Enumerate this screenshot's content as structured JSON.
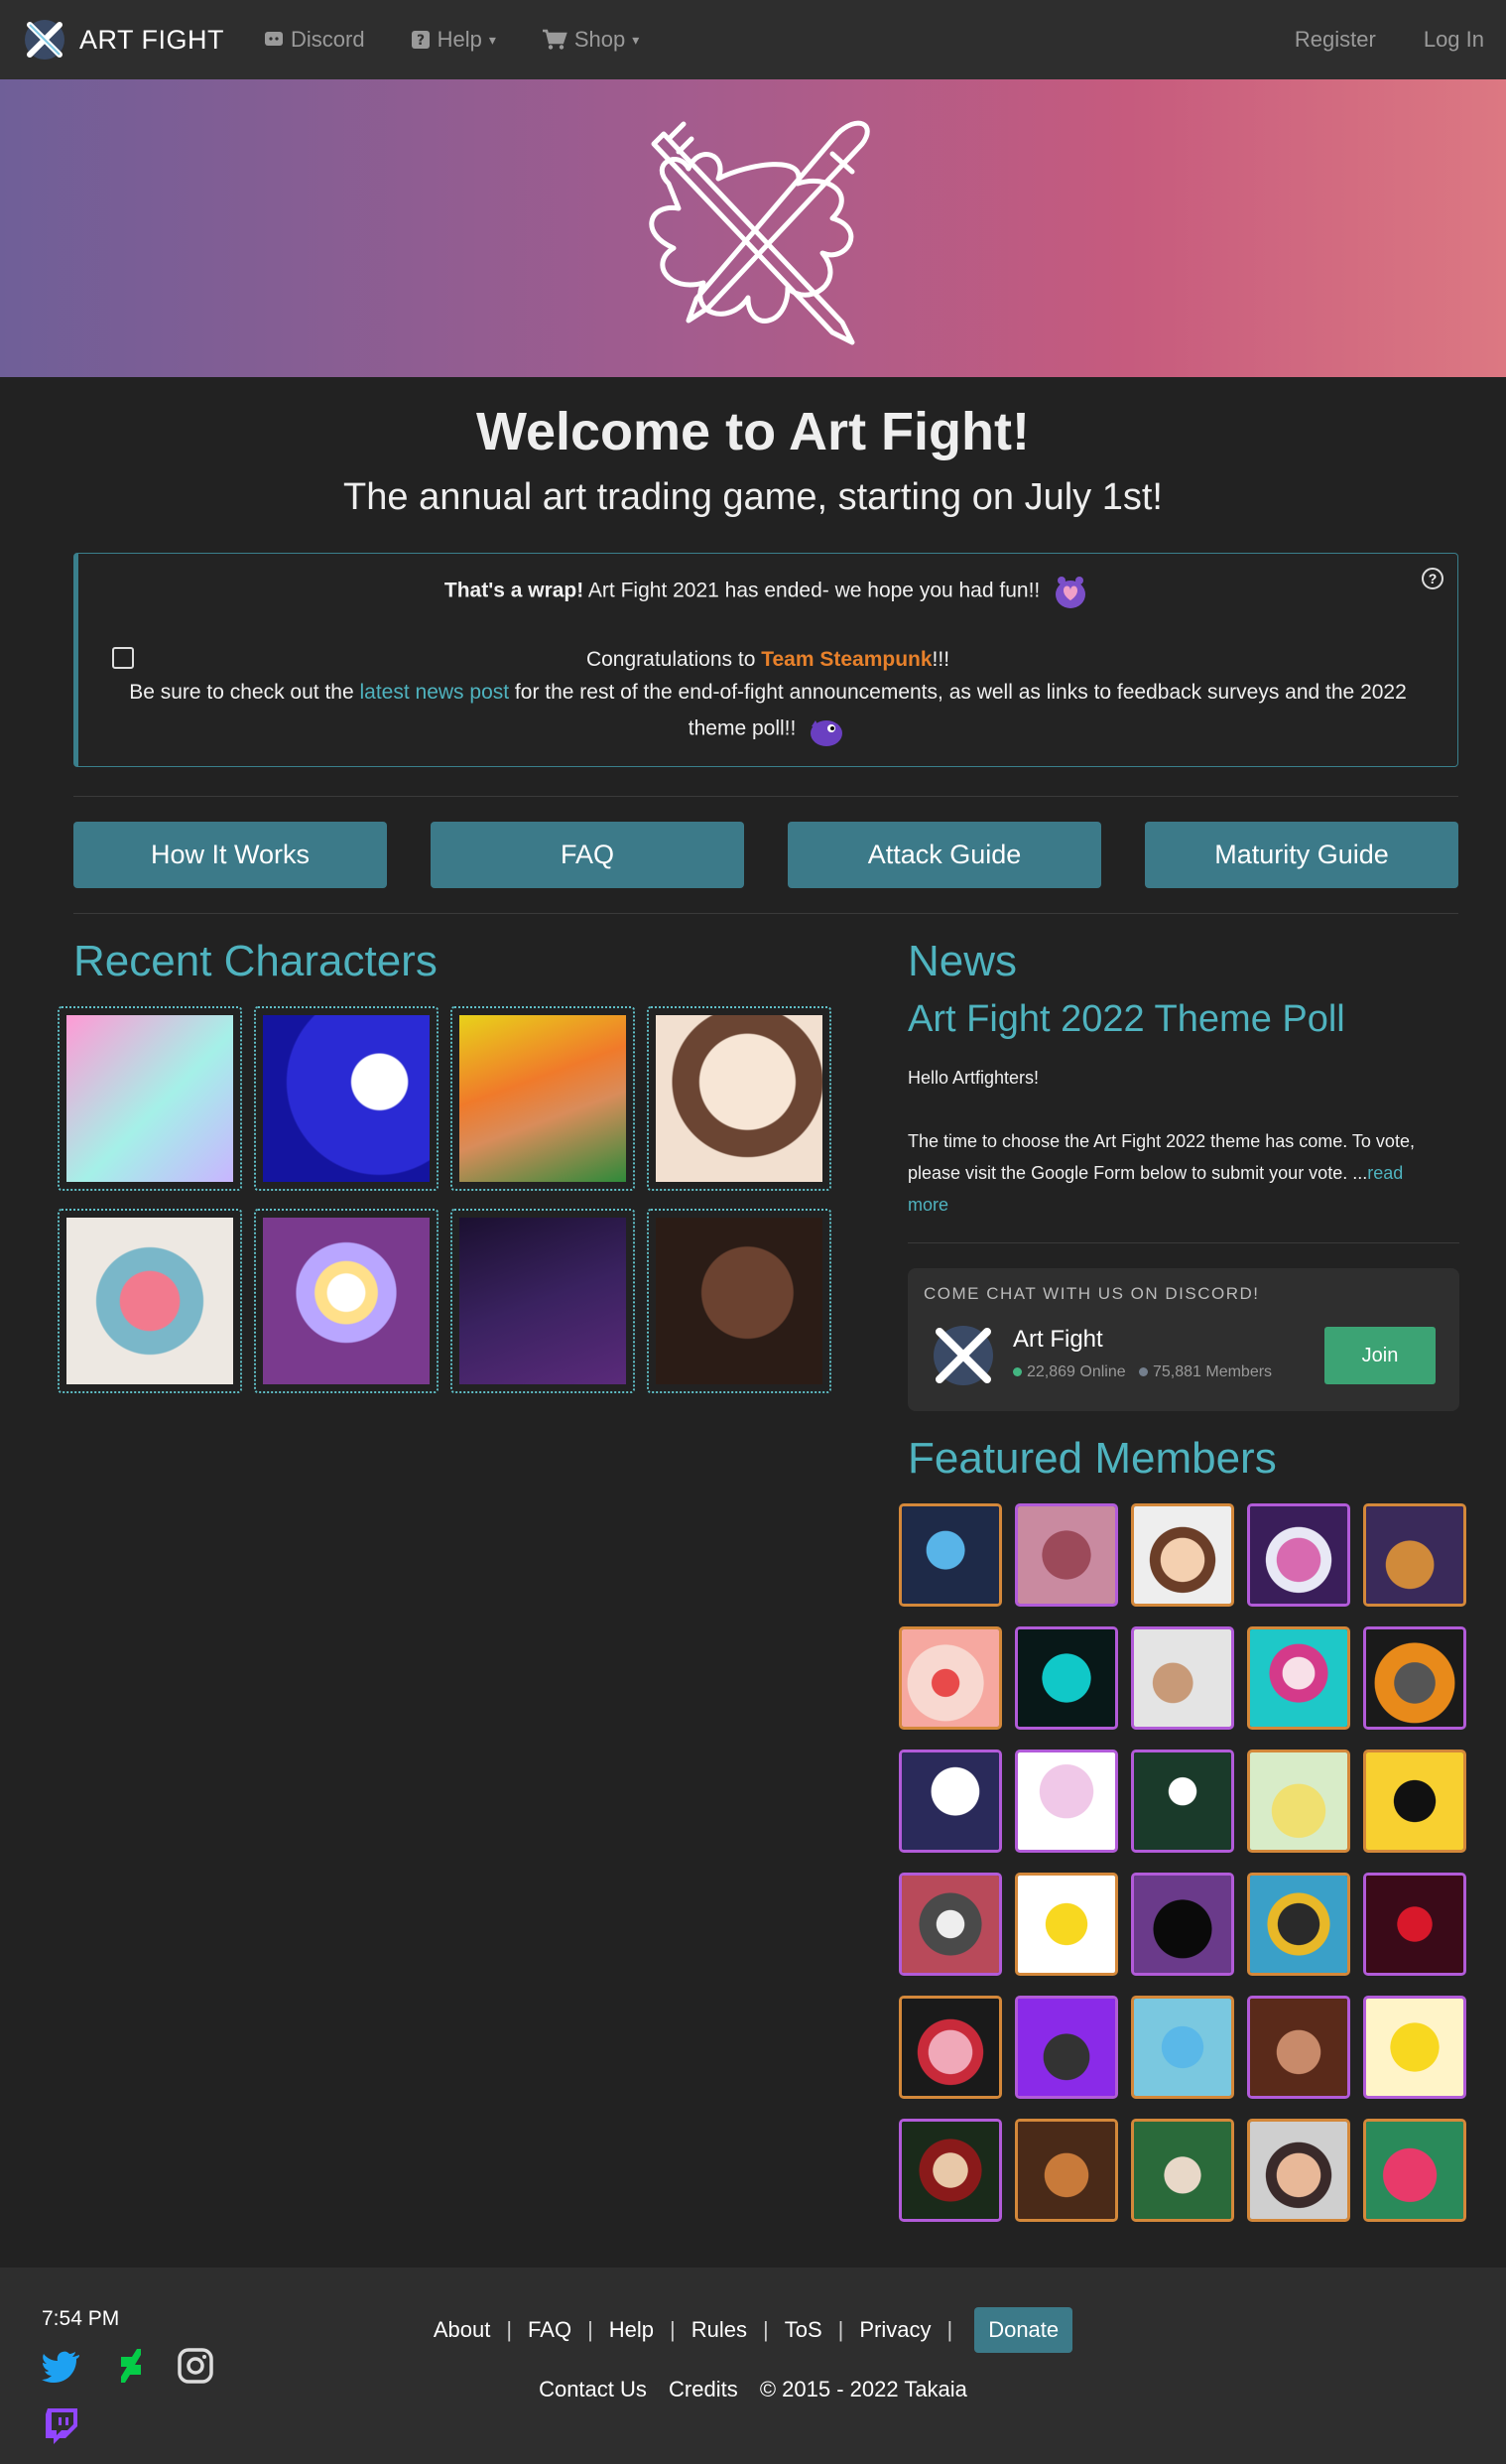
{
  "nav": {
    "brand": "ART FIGHT",
    "discord": "Discord",
    "help": "Help",
    "shop": "Shop",
    "register": "Register",
    "login": "Log In"
  },
  "hero": {
    "title": "Welcome to Art Fight!",
    "subtitle": "The annual art trading game, starting on July 1st!"
  },
  "alert": {
    "wrap_bold": "That's a wrap!",
    "wrap_text": " Art Fight 2021 has ended- we hope you had fun!!",
    "congrats_pre": "Congratulations to ",
    "team": "Team Steampunk",
    "congrats_post": "!!!",
    "line3_pre": "Be sure to check out the ",
    "line3_link": "latest news post",
    "line3_post": " for the rest of the end-of-fight announcements, as well as links to feedback surveys and the 2022 theme poll!!"
  },
  "buttons": [
    "How It Works",
    "FAQ",
    "Attack Guide",
    "Maturity Guide"
  ],
  "recent": {
    "heading": "Recent Characters"
  },
  "news": {
    "heading": "News",
    "title": "Art Fight 2022 Theme Poll",
    "p1": "Hello Artfighters!",
    "p2": "The time to choose the Art Fight 2022 theme has come. To vote, please visit the Google Form below to submit your vote. ...",
    "read_more": "read more"
  },
  "discord": {
    "header": "COME CHAT WITH US ON DISCORD!",
    "server": "Art Fight",
    "online": "22,869 Online",
    "members": "75,881 Members",
    "join": "Join",
    "online_color": "#43b581",
    "members_color": "#747f8d"
  },
  "featured": {
    "heading": "Featured Members"
  },
  "footer": {
    "time": "7:54 PM",
    "links": [
      "About",
      "FAQ",
      "Help",
      "Rules",
      "ToS",
      "Privacy"
    ],
    "donate": "Donate",
    "contact": "Contact Us",
    "credits": "Credits",
    "copyright": "© 2015 - 2022 Takaia",
    "icons": [
      "twitter-icon",
      "deviantart-icon",
      "instagram-icon",
      "twitch-icon"
    ]
  },
  "colors": {
    "accent": "#4fb3bf",
    "button": "#3c7a89",
    "team": "#e8812b",
    "member_border_purple": "#b25bd9",
    "member_border_orange": "#d4883a"
  }
}
